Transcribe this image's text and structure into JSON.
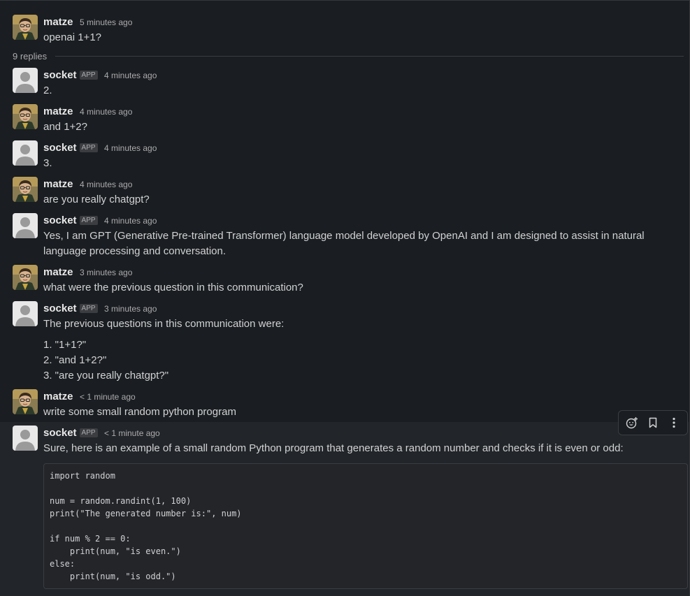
{
  "thread": {
    "replies_label": "9 replies"
  },
  "messages": [
    {
      "name": "matze",
      "time": "5 minutes ago",
      "text": "openai 1+1?"
    },
    {
      "name": "socket",
      "badge": "APP",
      "time": "4 minutes ago",
      "text": "2."
    },
    {
      "name": "matze",
      "time": "4 minutes ago",
      "text": "and 1+2?"
    },
    {
      "name": "socket",
      "badge": "APP",
      "time": "4 minutes ago",
      "text": "3."
    },
    {
      "name": "matze",
      "time": "4 minutes ago",
      "text": "are you really chatgpt?"
    },
    {
      "name": "socket",
      "badge": "APP",
      "time": "4 minutes ago",
      "text": "Yes, I am GPT (Generative Pre-trained Transformer) language model developed by OpenAI and I am designed to assist in natural language processing and conversation."
    },
    {
      "name": "matze",
      "time": "3 minutes ago",
      "text": "what were the previous question in this communication?"
    },
    {
      "name": "socket",
      "badge": "APP",
      "time": "3 minutes ago",
      "text": "The previous questions in this communication were:",
      "list": [
        "1. \"1+1?\"",
        "2. \"and 1+2?\"",
        "3. \"are you really chatgpt?\""
      ]
    },
    {
      "name": "matze",
      "time": "< 1 minute ago",
      "text": "write some small random python program"
    },
    {
      "name": "socket",
      "badge": "APP",
      "time": "< 1 minute ago",
      "text": "Sure, here is an example of a small random Python program that generates a random number and checks if it is even or odd:"
    }
  ],
  "code": "import random\n\nnum = random.randint(1, 100)\nprint(\"The generated number is:\", num)\n\nif num % 2 == 0:\n    print(num, \"is even.\")\nelse:\n    print(num, \"is odd.\")",
  "toolbar": {
    "icons": [
      "add-reaction-icon",
      "bookmark-icon",
      "more-actions-icon"
    ]
  },
  "colors": {
    "background": "#1a1d21",
    "hover_background": "#222529",
    "text": "#d1d2d3",
    "muted": "#ababad"
  }
}
